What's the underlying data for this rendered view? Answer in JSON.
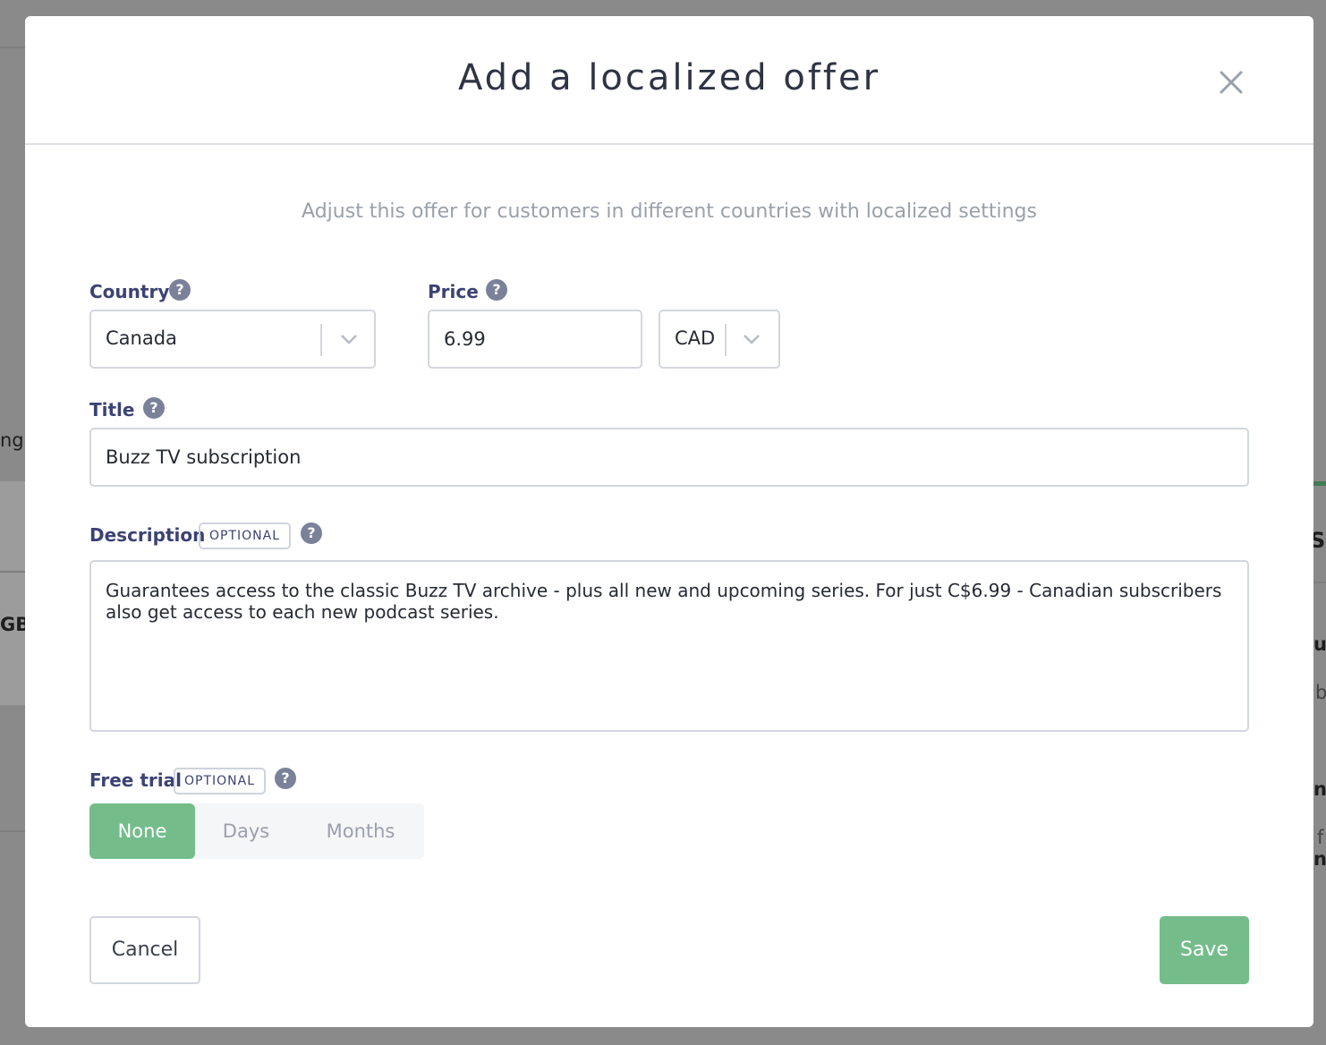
{
  "modal": {
    "title": "Add a localized offer",
    "subtitle": "Adjust this offer for customers in different countries with localized settings"
  },
  "form": {
    "country": {
      "label": "Country",
      "value": "Canada"
    },
    "price": {
      "label": "Price",
      "value": "6.99",
      "currency": "CAD"
    },
    "title": {
      "label": "Title",
      "value": "Buzz TV subscription"
    },
    "description": {
      "label": "Description",
      "badge": "OPTIONAL",
      "value": "Guarantees access to the classic Buzz TV archive - plus all new and upcoming series. For just C$6.99 - Canadian subscribers also get access to each new podcast series."
    },
    "free_trial": {
      "label": "Free trial",
      "badge": "OPTIONAL",
      "options": [
        "None",
        "Days",
        "Months"
      ],
      "selected": "None"
    },
    "help_glyph": "?"
  },
  "actions": {
    "cancel": "Cancel",
    "save": "Save"
  },
  "background": {
    "fragments": [
      "ng",
      "GBF",
      "Su",
      "u",
      "b",
      "n",
      "f",
      "n"
    ]
  },
  "colors": {
    "accent": "#74bd8b",
    "label": "#3c4373",
    "overlay": "#8a8a8a"
  },
  "icons": {
    "close": "close-icon",
    "help": "help-icon",
    "dropdown": "chevron-down-icon"
  }
}
